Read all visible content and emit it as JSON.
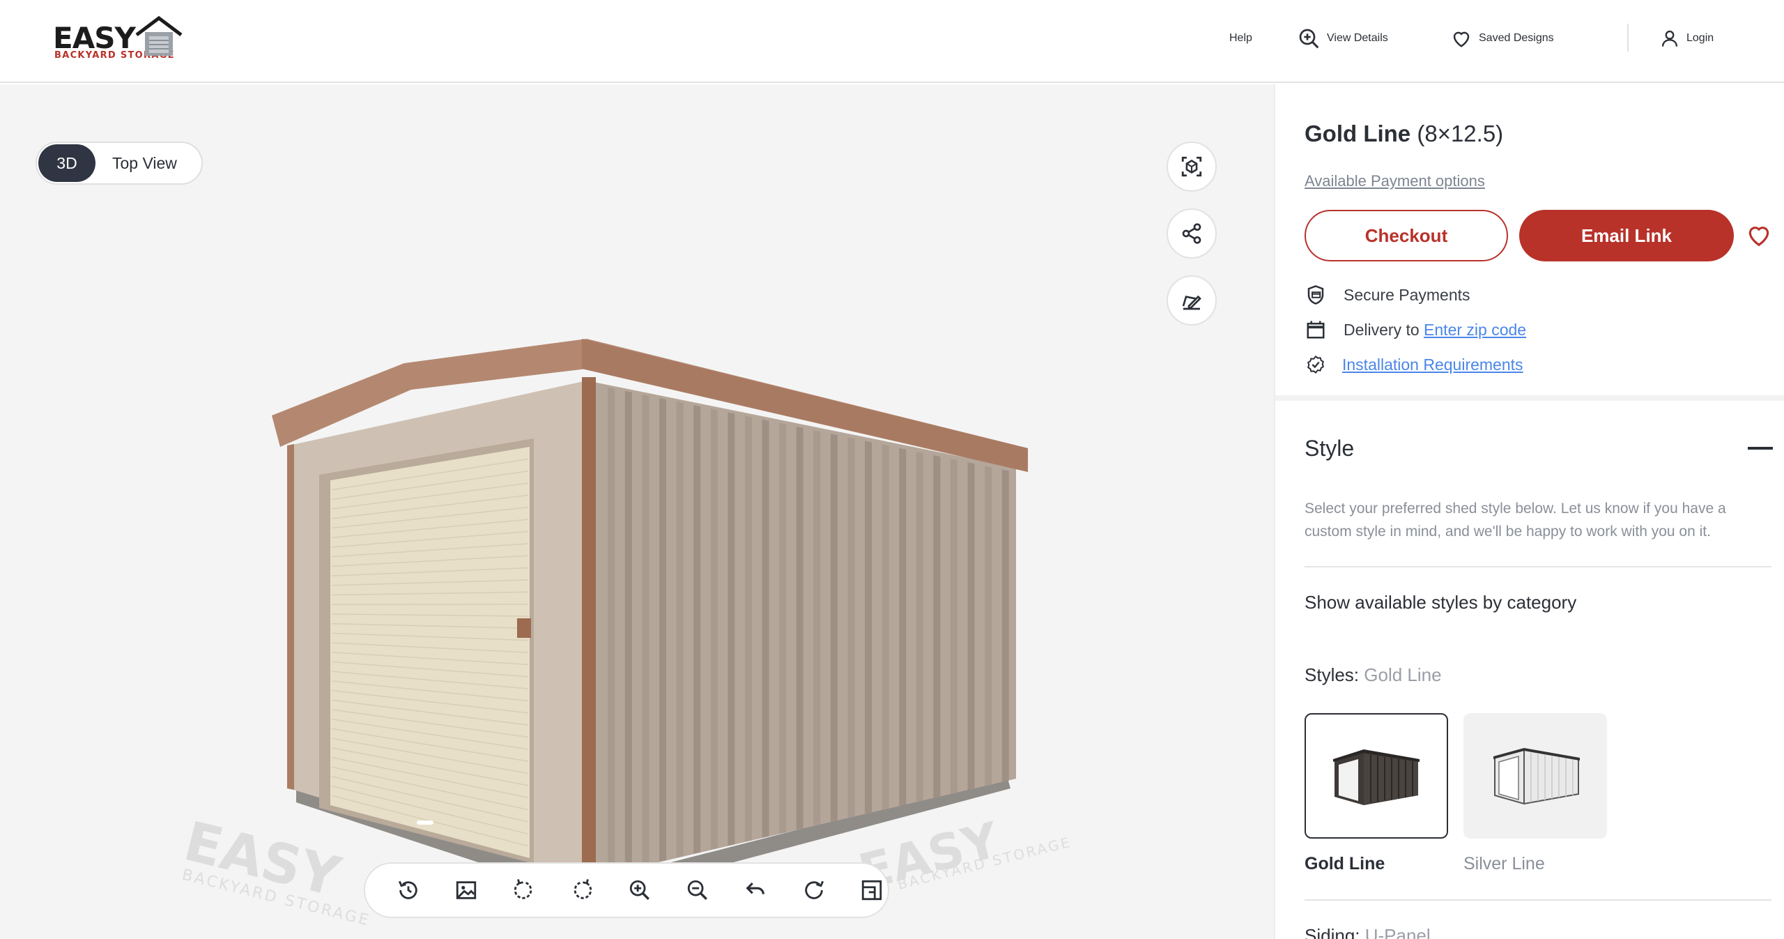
{
  "header": {
    "logo_word": "EASY",
    "logo_sub": "BACKYARD STORAGE",
    "nav": {
      "help": "Help",
      "view_details": "View Details",
      "saved_designs": "Saved Designs",
      "login": "Login"
    }
  },
  "viewer": {
    "toggle": {
      "active": "3D",
      "other": "Top View"
    },
    "side_buttons": [
      "ar-view-icon",
      "share-icon",
      "edit-design-icon"
    ],
    "toolbar": [
      "rotate-reset-icon",
      "image-icon",
      "rotate-left-icon",
      "rotate-right-icon",
      "zoom-in-icon",
      "zoom-out-icon",
      "undo-icon",
      "reset-icon",
      "layout-icon"
    ],
    "watermark": "EASY BACKYARD STORAGE"
  },
  "panel": {
    "product_name": "Gold Line",
    "product_size": "(8×12.5)",
    "payment_link": "Available Payment options",
    "checkout_label": "Checkout",
    "email_label": "Email Link",
    "secure": "Secure Payments",
    "delivery_prefix": "Delivery to",
    "delivery_link": "Enter zip code",
    "installation_link": "Installation Requirements",
    "style_heading": "Style",
    "style_description": "Select your preferred shed style below. Let us know if you have a custom style in mind, and we'll be happy to work with you on it.",
    "category_label": "Show available styles by category",
    "styles_label": "Styles:",
    "styles_selected": "Gold Line",
    "style_options": [
      {
        "label": "Gold Line",
        "selected": true
      },
      {
        "label": "Silver Line",
        "selected": false
      }
    ],
    "siding_label": "Siding:",
    "siding_selected": "U-Panel"
  },
  "colors": {
    "accent": "#b8322a",
    "dark": "#2f3542",
    "link": "#4a86e8",
    "viewer_bg": "#f4f4f4"
  }
}
